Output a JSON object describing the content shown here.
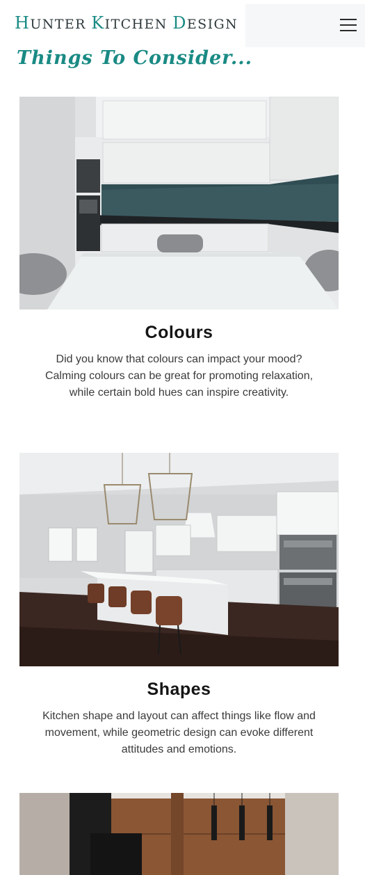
{
  "header": {
    "logo_parts": [
      {
        "cap": "H",
        "rest": "UNTER "
      },
      {
        "cap": "K",
        "rest": "ITCHEN "
      },
      {
        "cap": "D",
        "rest": "ESIGN"
      }
    ],
    "menu_icon": "hamburger-menu-icon"
  },
  "section": {
    "title": "Things To Consider..."
  },
  "cards": [
    {
      "title": "Colours",
      "text": "Did you know that colours can impact your mood? Calming colours can be great for promoting relaxation, while certain bold hues can inspire creativity."
    },
    {
      "title": "Shapes",
      "text": "Kitchen shape and layout can affect things like flow and movement, while geometric design can evoke different attitudes and emotions."
    }
  ],
  "colors": {
    "accent": "#1a8a84",
    "logo_text": "#2f3a3d"
  }
}
